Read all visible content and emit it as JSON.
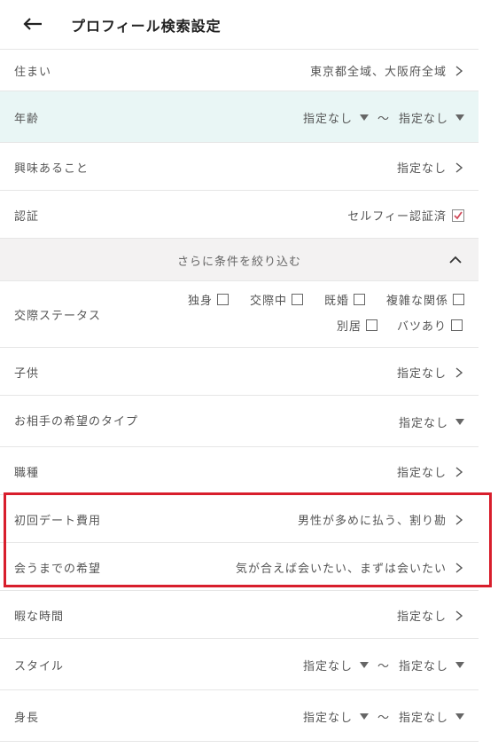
{
  "header": {
    "title": "プロフィール検索設定",
    "back_icon": "arrow-left-icon"
  },
  "rows": {
    "residence": {
      "label": "住まい",
      "value": "東京都全域、大阪府全域"
    },
    "age": {
      "label": "年齢",
      "from": "指定なし",
      "tilde": "〜",
      "to": "指定なし"
    },
    "interests": {
      "label": "興味あること",
      "value": "指定なし"
    },
    "verification": {
      "label": "認証",
      "value": "セルフィー認証済",
      "checked": true
    },
    "more_filters": {
      "label": "さらに条件を絞り込む"
    },
    "relationship": {
      "label": "交際ステータス",
      "options": [
        "独身",
        "交際中",
        "既婚",
        "複雑な関係",
        "別居",
        "バツあり"
      ]
    },
    "children": {
      "label": "子供",
      "value": "指定なし"
    },
    "partner_type": {
      "label": "お相手の希望のタイプ",
      "value": "指定なし"
    },
    "occupation": {
      "label": "職種",
      "value": "指定なし"
    },
    "first_date_cost": {
      "label": "初回デート費用",
      "value": "男性が多めに払う、割り勘"
    },
    "before_meeting": {
      "label": "会うまでの希望",
      "value": "気が合えば会いたい、まずは会いたい"
    },
    "free_time": {
      "label": "暇な時間",
      "value": "指定なし"
    },
    "style": {
      "label": "スタイル",
      "from": "指定なし",
      "tilde": "〜",
      "to": "指定なし"
    },
    "height": {
      "label": "身長",
      "from": "指定なし",
      "tilde": "〜",
      "to": "指定なし"
    }
  },
  "colors": {
    "age_highlight": "#e9f6f5",
    "section_bg": "#f3f2f2",
    "highlight_border": "#d81e2c",
    "check_red": "#d04a5a"
  }
}
